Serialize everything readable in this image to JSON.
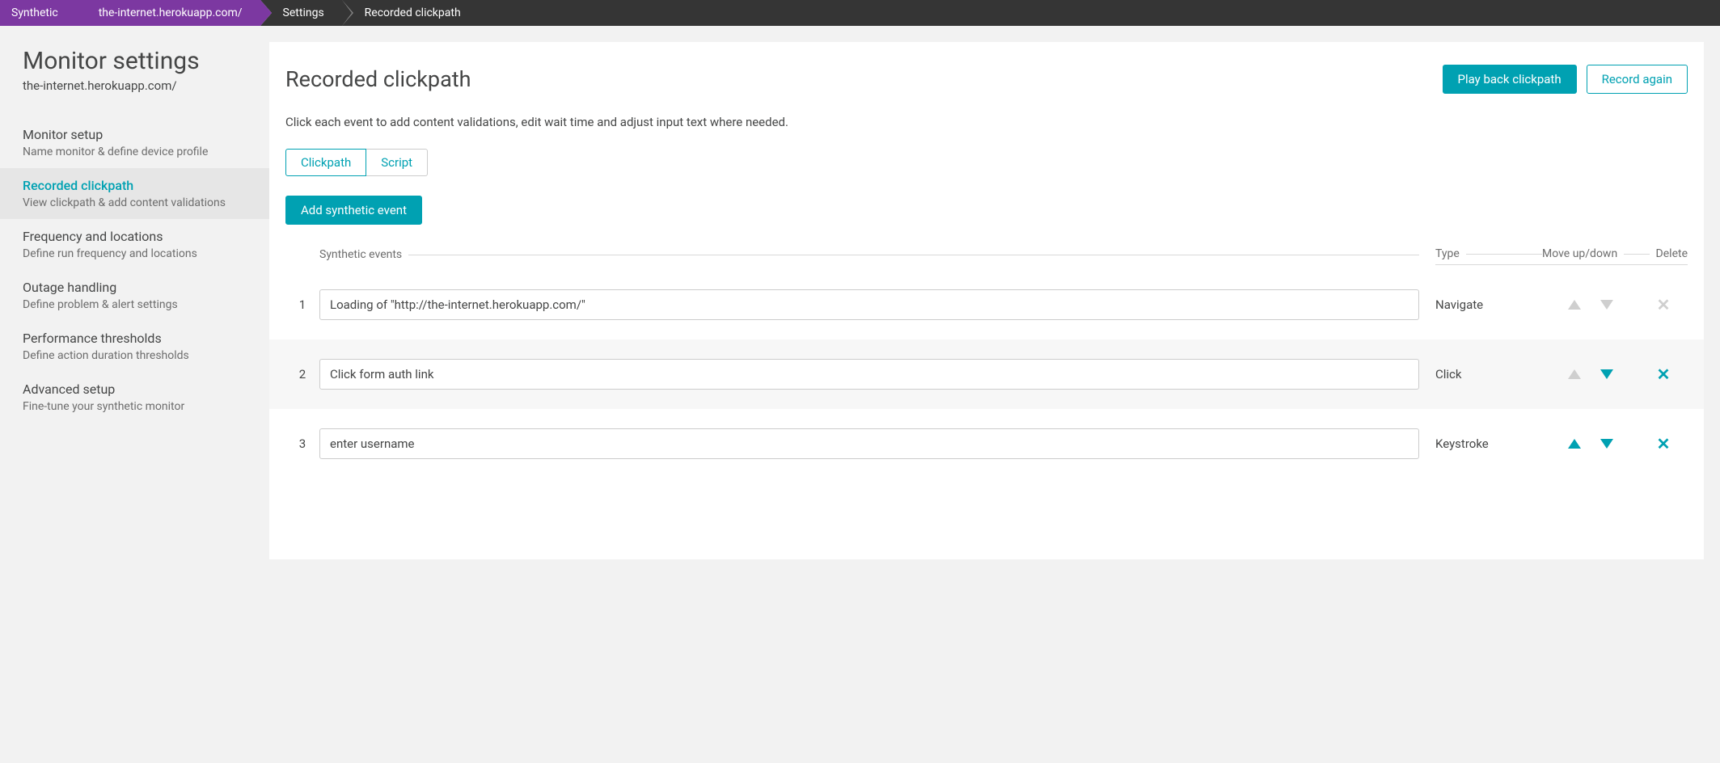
{
  "breadcrumb": [
    {
      "label": "Synthetic",
      "style": "purple",
      "sep": "pp"
    },
    {
      "label": "the-internet.herokuapp.com/",
      "style": "purple",
      "sep": "pd"
    },
    {
      "label": "Settings",
      "style": "dark",
      "sep": "dd"
    },
    {
      "label": "Recorded clickpath",
      "style": "dark",
      "sep": ""
    }
  ],
  "sidebar": {
    "heading": "Monitor settings",
    "subtitle": "the-internet.herokuapp.com/",
    "items": [
      {
        "title": "Monitor setup",
        "desc": "Name monitor & define device profile",
        "active": false
      },
      {
        "title": "Recorded clickpath",
        "desc": "View clickpath & add content validations",
        "active": true
      },
      {
        "title": "Frequency and locations",
        "desc": "Define run frequency and locations",
        "active": false
      },
      {
        "title": "Outage handling",
        "desc": "Define problem & alert settings",
        "active": false
      },
      {
        "title": "Performance thresholds",
        "desc": "Define action duration thresholds",
        "active": false
      },
      {
        "title": "Advanced setup",
        "desc": "Fine-tune your synthetic monitor",
        "active": false
      }
    ]
  },
  "main": {
    "title": "Recorded clickpath",
    "play_label": "Play back clickpath",
    "record_label": "Record again",
    "helptext": "Click each event to add content validations, edit wait time and adjust input text where needed.",
    "tabs": {
      "clickpath": "Clickpath",
      "script": "Script",
      "active": "clickpath"
    },
    "add_label": "Add synthetic event",
    "columns": {
      "events": "Synthetic events",
      "type": "Type",
      "move": "Move up/down",
      "del": "Delete"
    },
    "rows": [
      {
        "idx": "1",
        "name": "Loading of \"http://the-internet.herokuapp.com/\"",
        "type": "Navigate",
        "up": false,
        "down": false,
        "del": false,
        "alt": false
      },
      {
        "idx": "2",
        "name": "Click form auth link",
        "type": "Click",
        "up": false,
        "down": true,
        "del": true,
        "alt": true
      },
      {
        "idx": "3",
        "name": "enter username",
        "type": "Keystroke",
        "up": true,
        "down": true,
        "del": true,
        "alt": false
      }
    ]
  }
}
